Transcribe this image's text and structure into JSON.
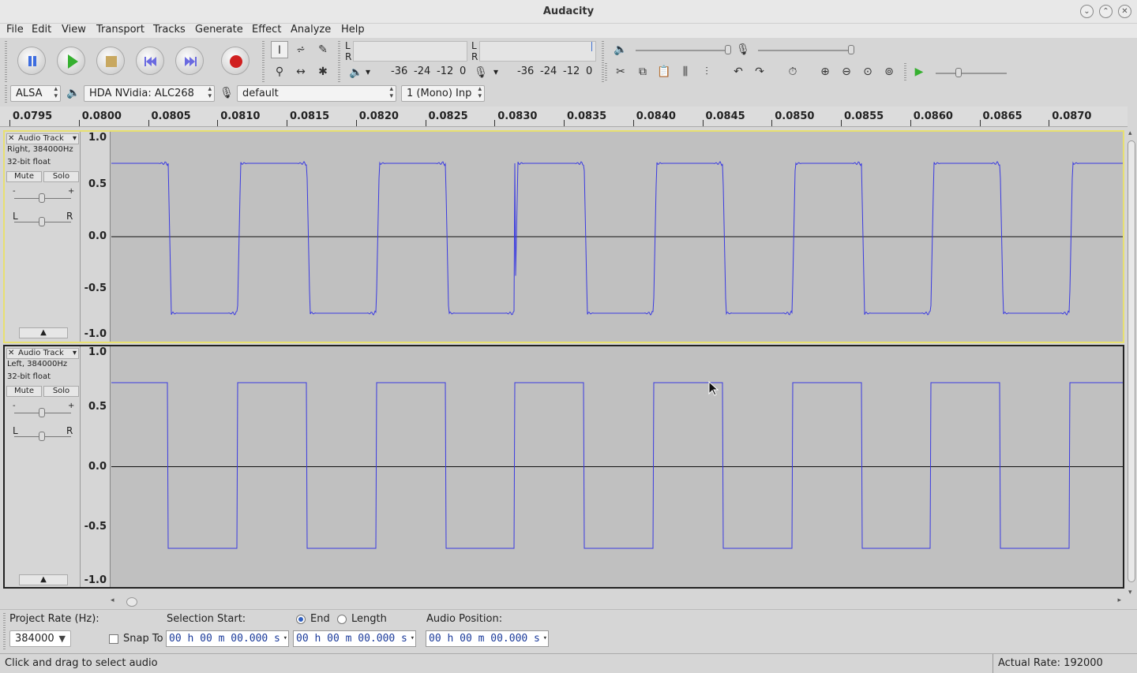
{
  "window": {
    "title": "Audacity"
  },
  "menu": [
    "File",
    "Edit",
    "View",
    "Transport",
    "Tracks",
    "Generate",
    "Effect",
    "Analyze",
    "Help"
  ],
  "meters": {
    "play": {
      "l": "L",
      "r": "R",
      "ticks": [
        "-36",
        "-24",
        "-12",
        "0"
      ]
    },
    "rec": {
      "l": "L",
      "r": "R",
      "ticks": [
        "-36",
        "-24",
        "-12",
        "0"
      ]
    }
  },
  "device": {
    "host": "ALSA",
    "output": "HDA NVidia: ALC268",
    "input": "default",
    "channels": "1 (Mono) Inp"
  },
  "ruler": [
    "0.0795",
    "0.0800",
    "0.0805",
    "0.0810",
    "0.0815",
    "0.0820",
    "0.0825",
    "0.0830",
    "0.0835",
    "0.0840",
    "0.0845",
    "0.0850",
    "0.0855",
    "0.0860",
    "0.0865",
    "0.0870"
  ],
  "tracks": [
    {
      "name": "Audio Track",
      "info1": "Right, 384000Hz",
      "info2": "32-bit float",
      "mute": "Mute",
      "solo": "Solo",
      "gain_minus": "-",
      "gain_plus": "+",
      "pan_l": "L",
      "pan_r": "R",
      "scale": [
        "1.0",
        "0.5",
        "0.0",
        "-0.5",
        "-1.0"
      ]
    },
    {
      "name": "Audio Track",
      "info1": "Left, 384000Hz",
      "info2": "32-bit float",
      "mute": "Mute",
      "solo": "Solo",
      "gain_minus": "-",
      "gain_plus": "+",
      "pan_l": "L",
      "pan_r": "R",
      "scale": [
        "1.0",
        "0.5",
        "0.0",
        "-0.5",
        "-1.0"
      ]
    }
  ],
  "selection": {
    "rate_label": "Project Rate (Hz):",
    "rate": "384000",
    "snap": "Snap To",
    "start_label": "Selection Start:",
    "end_label": "End",
    "length_label": "Length",
    "pos_label": "Audio Position:",
    "start": "00 h 00 m 00.000 s",
    "end": "00 h 00 m 00.000 s",
    "pos": "00 h 00 m 00.000 s"
  },
  "status": {
    "hint": "Click and drag to select audio",
    "rate": "Actual Rate: 192000"
  },
  "colors": {
    "wave": "#3a3ae0",
    "selected_border": "#e8e070"
  }
}
